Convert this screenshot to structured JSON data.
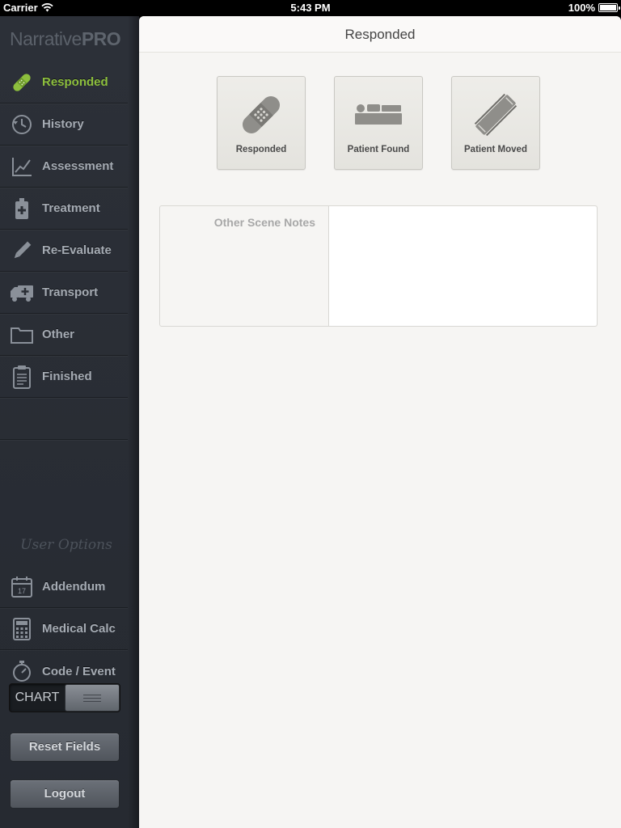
{
  "status_bar": {
    "carrier": "Carrier",
    "time": "5:43 PM",
    "battery": "100%"
  },
  "app": {
    "brand_light": "Narrative",
    "brand_bold": "PRO"
  },
  "sidebar": {
    "items": [
      {
        "label": "Responded",
        "icon": "bandage-icon",
        "active": true
      },
      {
        "label": "History",
        "icon": "history-icon"
      },
      {
        "label": "Assessment",
        "icon": "chart-line-icon"
      },
      {
        "label": "Treatment",
        "icon": "iv-bag-icon"
      },
      {
        "label": "Re-Evaluate",
        "icon": "pencil-icon"
      },
      {
        "label": "Transport",
        "icon": "ambulance-icon"
      },
      {
        "label": "Other",
        "icon": "folder-icon"
      },
      {
        "label": "Finished",
        "icon": "clipboard-icon"
      }
    ],
    "user_options_heading": "User Options",
    "options": [
      {
        "label": "Addendum",
        "icon": "calendar-icon"
      },
      {
        "label": "Medical Calc",
        "icon": "calculator-icon"
      },
      {
        "label": "Code / Event",
        "icon": "stopwatch-icon"
      }
    ],
    "chart_toggle_label": "CHART",
    "reset_label": "Reset Fields",
    "logout_label": "Logout"
  },
  "main": {
    "title": "Responded",
    "tiles": [
      {
        "label": "Responded",
        "icon": "bandage-icon"
      },
      {
        "label": "Patient Found",
        "icon": "patient-bed-icon"
      },
      {
        "label": "Patient Moved",
        "icon": "stretcher-icon"
      }
    ],
    "notes_label": "Other Scene Notes",
    "notes_value": ""
  },
  "colors": {
    "accent": "#8dbf3d",
    "sidebar_bg": "#2a2e35",
    "panel_bg": "#f6f5f3"
  }
}
